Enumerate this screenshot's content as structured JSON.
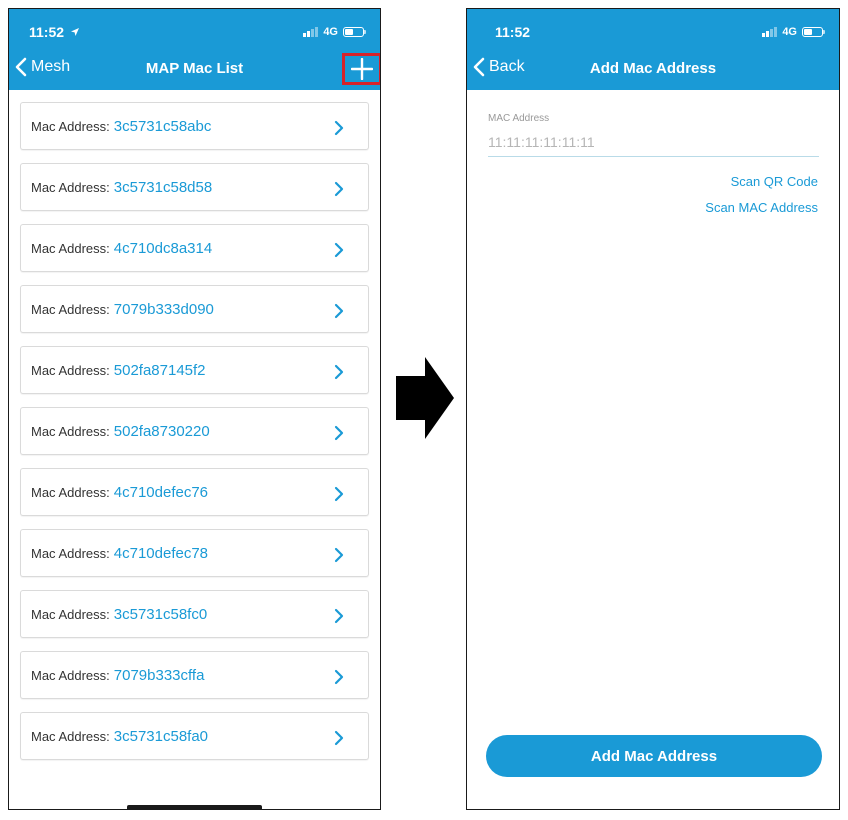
{
  "list_screen": {
    "status": {
      "time": "11:52",
      "network": "4G"
    },
    "back_label": "Mesh",
    "title": "MAP Mac List",
    "mac_label": "Mac Address:",
    "macs": [
      "3c5731c58abc",
      "3c5731c58d58",
      "4c710dc8a314",
      "7079b333d090",
      "502fa87145f2",
      "502fa8730220",
      "4c710defec76",
      "4c710defec78",
      "3c5731c58fc0",
      "7079b333cffa",
      "3c5731c58fa0"
    ]
  },
  "add_screen": {
    "status": {
      "time": "11:52",
      "network": "4G"
    },
    "back_label": "Back",
    "title": "Add Mac Address",
    "field_label": "MAC Address",
    "field_value": "",
    "field_placeholder": "11:11:11:11:11:11",
    "scan_qr_label": "Scan QR Code",
    "scan_mac_label": "Scan MAC Address",
    "submit_label": "Add Mac Address"
  },
  "colors": {
    "accent": "#1a9ad6",
    "highlight": "#d8232a"
  }
}
